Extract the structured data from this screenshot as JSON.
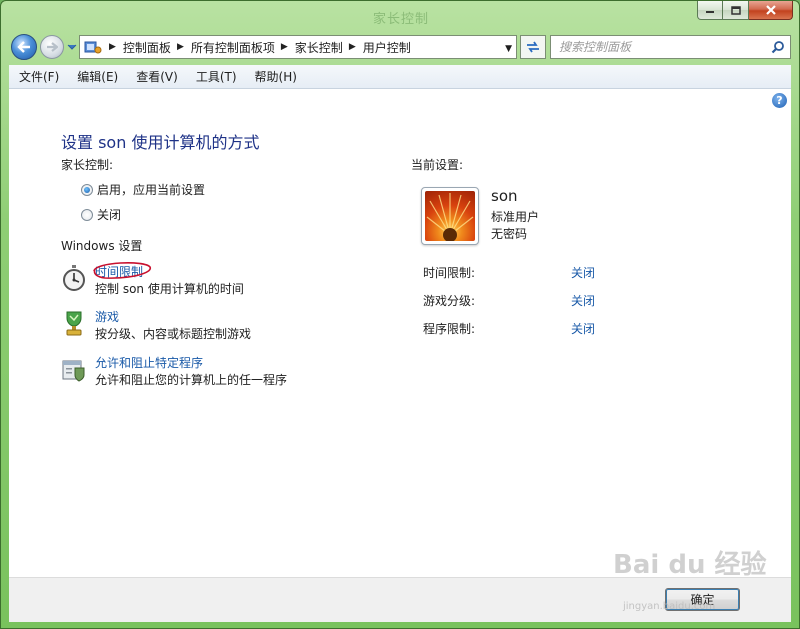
{
  "window": {
    "title": "家长控制",
    "colors": {
      "frame": "#8fce75",
      "link": "#1a5aa8",
      "heading": "#1e3287"
    }
  },
  "address": {
    "crumbs": [
      "控制面板",
      "所有控制面板项",
      "家长控制",
      "用户控制"
    ]
  },
  "search": {
    "placeholder": "搜索控制面板"
  },
  "menu": [
    "文件(F)",
    "编辑(E)",
    "查看(V)",
    "工具(T)",
    "帮助(H)"
  ],
  "main": {
    "heading": "设置 son 使用计算机的方式",
    "parental_label": "家长控制:",
    "options": [
      {
        "label": "启用，应用当前设置",
        "selected": true
      },
      {
        "label": "关闭",
        "selected": false
      }
    ],
    "windows_label": "Windows 设置",
    "settings": [
      {
        "link": "时间限制",
        "desc": "控制 son 使用计算机的时间",
        "icon": "stopwatch-icon"
      },
      {
        "link": "游戏",
        "desc": "按分级、内容或标题控制游戏",
        "icon": "game-trophy-icon"
      },
      {
        "link": "允许和阻止特定程序",
        "desc": "允许和阻止您的计算机上的任一程序",
        "icon": "program-shield-icon"
      }
    ]
  },
  "current": {
    "label": "当前设置:",
    "user": {
      "name": "son",
      "type": "标准用户",
      "password": "无密码"
    },
    "rows": [
      {
        "label": "时间限制:",
        "value": "关闭"
      },
      {
        "label": "游戏分级:",
        "value": "关闭"
      },
      {
        "label": "程序限制:",
        "value": "关闭"
      }
    ]
  },
  "footer": {
    "ok_label": "确定"
  },
  "watermark": {
    "brand": "Bai du 经验",
    "url": "jingyan.baidu.com"
  }
}
